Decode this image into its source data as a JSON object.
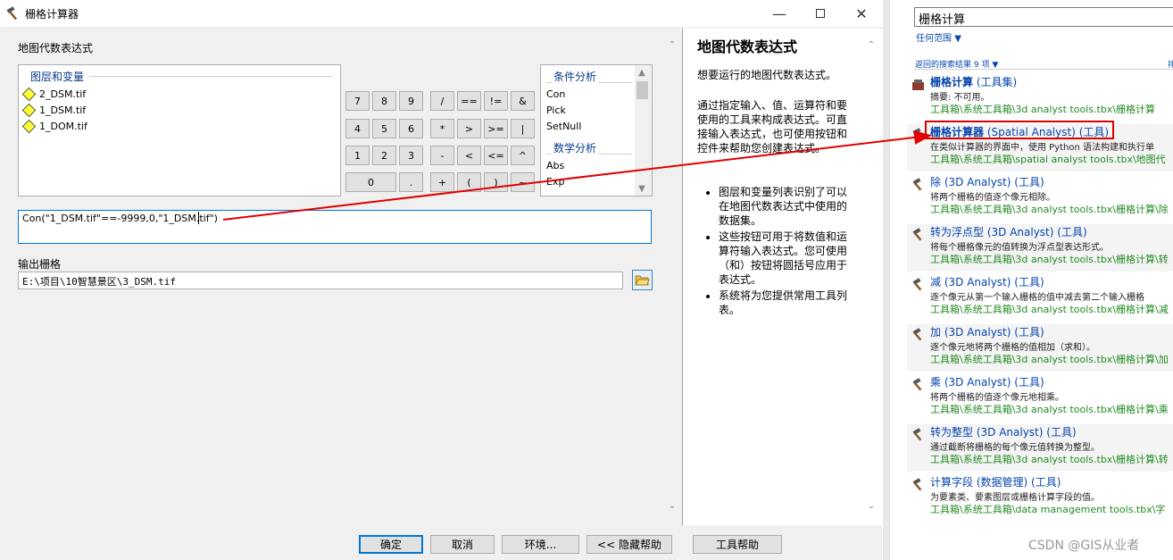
{
  "dialog": {
    "title": "栅格计算器",
    "expression_label": "地图代数表达式",
    "layers_legend": "图层和变量",
    "layers": [
      "2_DSM.tif",
      "1_DSM.tif",
      "1_DOM.tif"
    ],
    "buttons": [
      {
        "label": "7"
      },
      {
        "label": "8"
      },
      {
        "label": "9"
      },
      {
        "label": "/"
      },
      {
        "label": "=="
      },
      {
        "label": "!="
      },
      {
        "label": "&"
      },
      {
        "label": "4"
      },
      {
        "label": "5"
      },
      {
        "label": "6"
      },
      {
        "label": "*"
      },
      {
        "label": ">"
      },
      {
        "label": ">="
      },
      {
        "label": "|"
      },
      {
        "label": "1"
      },
      {
        "label": "2"
      },
      {
        "label": "3"
      },
      {
        "label": "-"
      },
      {
        "label": "<"
      },
      {
        "label": "<="
      },
      {
        "label": "^"
      },
      {
        "label": "0"
      },
      {
        "label": "."
      },
      {
        "label": "+"
      },
      {
        "label": "("
      },
      {
        "label": ")"
      },
      {
        "label": "~"
      }
    ],
    "conditional_head": "条件分析",
    "conditional": [
      "Con",
      "Pick",
      "SetNull"
    ],
    "math_head": "数学分析",
    "math": [
      "Abs",
      "Exp"
    ],
    "expression": "Con(\"1_DSM.tif\"==-9999,0,\"1_DSM.tif\")",
    "output_label": "输出栅格",
    "output_path": "E:\\项目\\10智慧景区\\3_DSM.tif",
    "help": {
      "title": "地图代数表达式",
      "p1": "想要运行的地图代数表达式。",
      "p2": "通过指定输入、值、运算符和要使用的工具来构成表达式。可直接输入表达式，也可使用按钮和控件来帮助您创建表达式。",
      "bullets": [
        "图层和变量列表识别了可以在地图代数表达式中使用的数据集。",
        "这些按钮可用于将数值和运算符输入表达式。您可使用（和）按钮将圆括号应用于表达式。",
        "系统将为您提供常用工具列表。"
      ]
    },
    "footer": {
      "ok": "确定",
      "cancel": "取消",
      "env": "环境...",
      "hide_help": "<< 隐藏帮助",
      "tool_help": "工具帮助"
    }
  },
  "search": {
    "query": "栅格计算",
    "scope": "任何范围",
    "results_count": "返回的搜索结果 9 项",
    "sort": "排",
    "results": [
      {
        "title": "栅格计算",
        "title_bold": true,
        "type": " (工具集)",
        "desc": "摘要: 不可用。",
        "path": "工具箱\\系统工具箱\\3d analyst tools.tbx\\栅格计算",
        "alt": false,
        "icon": "toolset-icon"
      },
      {
        "title": "栅格计算器",
        "title_bold": true,
        "type": " (Spatial Analyst) (工具)",
        "desc": "在类似计算器的界面中，使用 Python 语法构建和执行单",
        "path": "工具箱\\系统工具箱\\spatial analyst tools.tbx\\地图代",
        "alt": true,
        "icon": "hammer-icon"
      },
      {
        "title": "除",
        "title_bold": false,
        "type": " (3D Analyst) (工具)",
        "desc": "将两个栅格的值逐个像元相除。",
        "path": "工具箱\\系统工具箱\\3d analyst tools.tbx\\栅格计算\\除",
        "alt": false,
        "icon": "hammer-icon"
      },
      {
        "title": "转为浮点型",
        "title_bold": false,
        "type": " (3D Analyst) (工具)",
        "desc": "将每个栅格像元的值转换为浮点型表达形式。",
        "path": "工具箱\\系统工具箱\\3d analyst tools.tbx\\栅格计算\\转",
        "alt": true,
        "icon": "hammer-icon"
      },
      {
        "title": "减",
        "title_bold": false,
        "type": " (3D Analyst) (工具)",
        "desc": "逐个像元从第一个输入栅格的值中减去第二个输入栅格",
        "path": "工具箱\\系统工具箱\\3d analyst tools.tbx\\栅格计算\\减",
        "alt": false,
        "icon": "hammer-icon"
      },
      {
        "title": "加",
        "title_bold": false,
        "type": " (3D Analyst) (工具)",
        "desc": "逐个像元地将两个栅格的值相加（求和）。",
        "path": "工具箱\\系统工具箱\\3d analyst tools.tbx\\栅格计算\\加",
        "alt": true,
        "icon": "hammer-icon"
      },
      {
        "title": "乘",
        "title_bold": false,
        "type": " (3D Analyst) (工具)",
        "desc": "将两个栅格的值逐个像元地相乘。",
        "path": "工具箱\\系统工具箱\\3d analyst tools.tbx\\栅格计算\\乘",
        "alt": false,
        "icon": "hammer-icon"
      },
      {
        "title": "转为整型",
        "title_bold": false,
        "type": " (3D Analyst) (工具)",
        "desc": "通过截断将栅格的每个像元值转换为整型。",
        "path": "工具箱\\系统工具箱\\3d analyst tools.tbx\\栅格计算\\转",
        "alt": true,
        "icon": "hammer-icon"
      },
      {
        "title": "计算字段",
        "title_bold": false,
        "type": " (数据管理) (工具)",
        "desc": "为要素类、要素图层或栅格计算字段的值。",
        "path": "工具箱\\系统工具箱\\data management tools.tbx\\字",
        "alt": false,
        "icon": "hammer-icon"
      }
    ]
  },
  "watermark": "CSDN @GIS从业者",
  "colors": {
    "accent": "#0078d7",
    "link": "#0645ad",
    "path": "#228b22",
    "annotation": "#e00000"
  }
}
